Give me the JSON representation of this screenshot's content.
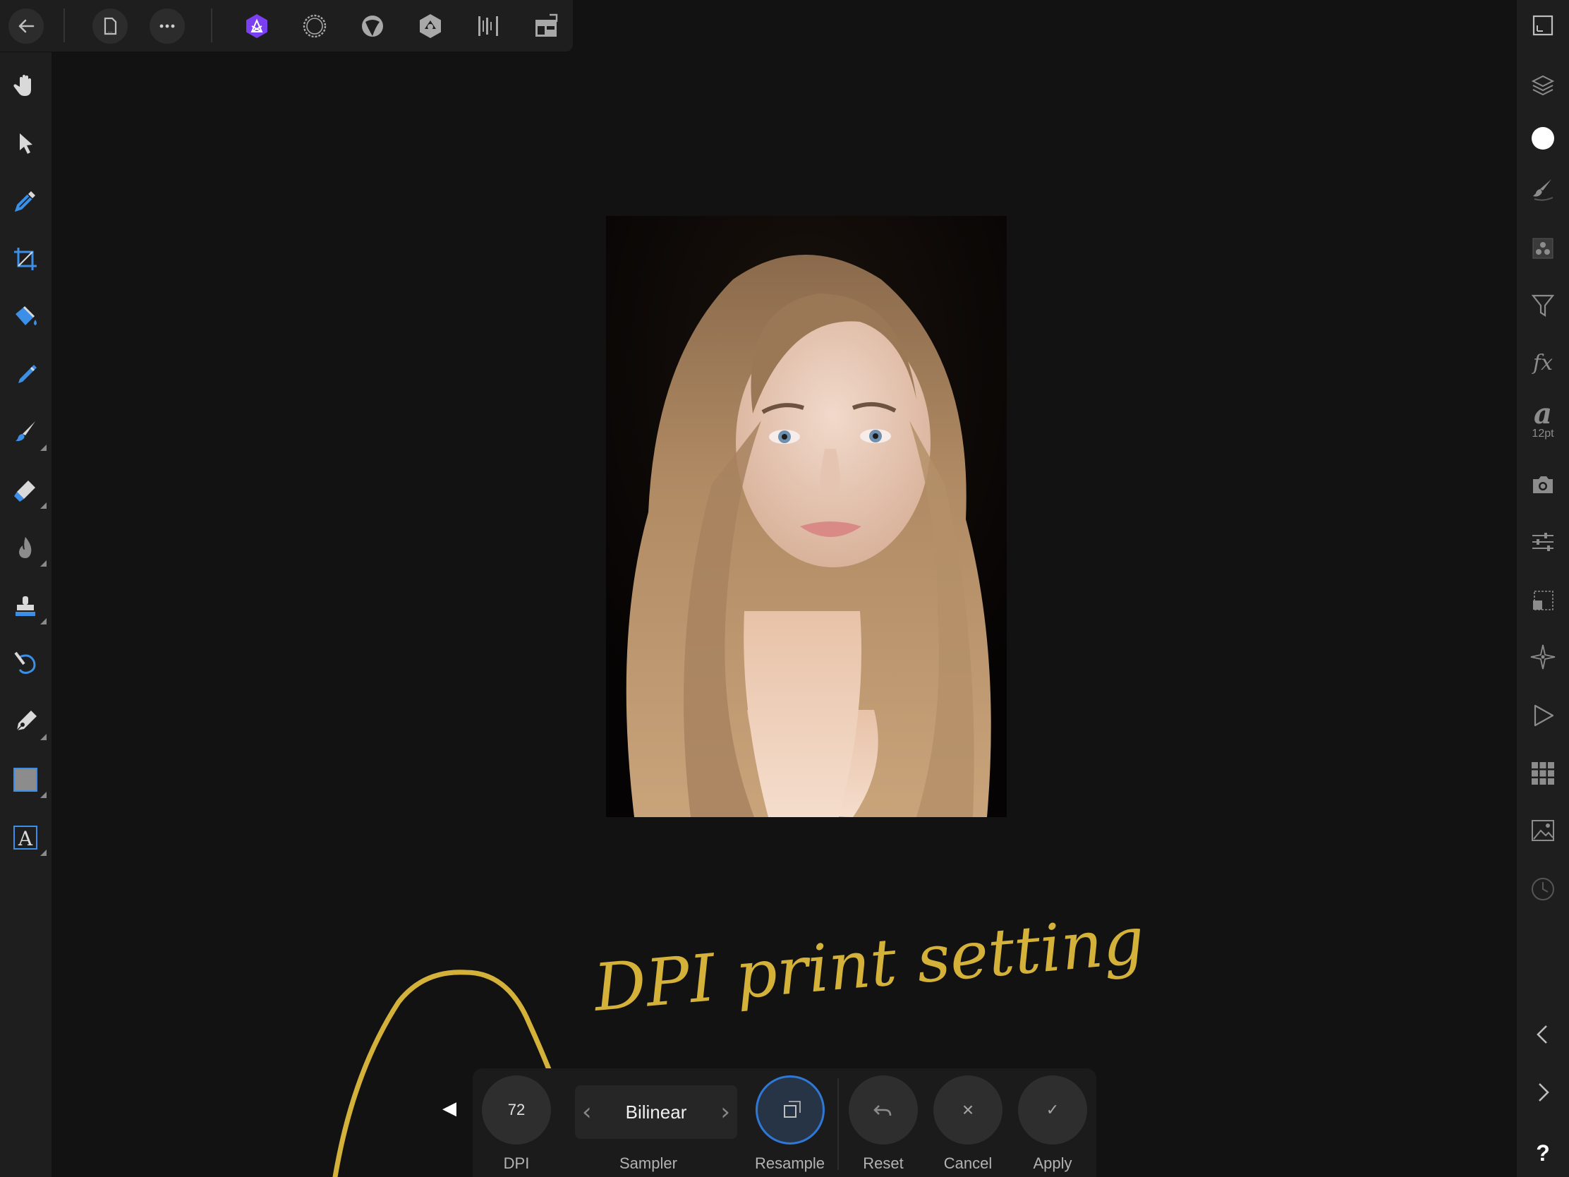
{
  "topbar": {
    "buttons": [
      "back-icon",
      "document-icon",
      "more-icon",
      "photo-persona-icon",
      "liquify-persona-icon",
      "develop-persona-icon",
      "tone-mapping-persona-icon",
      "export-persona-icon",
      "studio-icon"
    ],
    "active_color": "#7b3ff2"
  },
  "left_tools": [
    "hand-icon",
    "move-icon",
    "color-picker-icon",
    "crop-icon",
    "flood-fill-icon",
    "selection-brush-icon",
    "paint-brush-icon",
    "erase-brush-icon",
    "dodge-burn-icon",
    "clone-icon",
    "undo-brush-icon",
    "pen-icon",
    "shape-icon",
    "text-icon"
  ],
  "right_panel": {
    "items": [
      "view-mode-icon",
      "layers-icon",
      "color-icon",
      "brushes-icon",
      "channels-icon",
      "filters-icon",
      "fx-icon",
      "text-style-icon",
      "snapshots-icon",
      "adjustments-icon",
      "transform-icon",
      "navigator-icon",
      "macro-icon",
      "swatches-icon",
      "stock-icon",
      "history-icon",
      "prev-icon",
      "next-icon",
      "help-icon"
    ],
    "fx_label": "fx",
    "text_glyph": "a",
    "text_size": "12pt",
    "help_label": "?"
  },
  "annotation": {
    "handwriting": "DPI print setting",
    "color": "#d4b23a"
  },
  "context_bar": {
    "dpi_value": "72",
    "dpi_label": "DPI",
    "sampler_value": "Bilinear",
    "sampler_label": "Sampler",
    "resample_label": "Resample",
    "reset_label": "Reset",
    "cancel_label": "Cancel",
    "apply_label": "Apply",
    "cancel_glyph": "×",
    "apply_glyph": "✓"
  }
}
